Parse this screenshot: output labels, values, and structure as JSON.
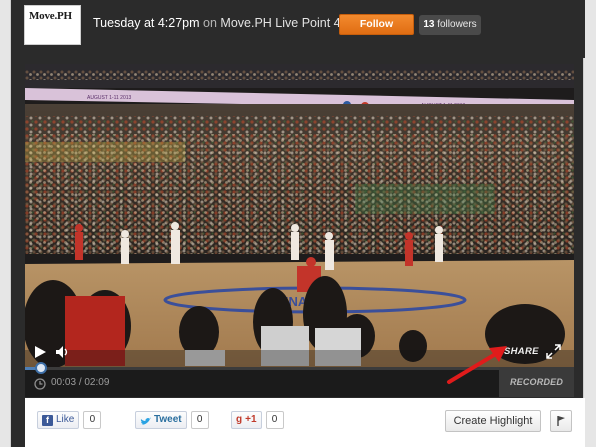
{
  "header": {
    "logo_text": "Move.PH",
    "post_time": "Tuesday at 4:27pm",
    "on_word": "on",
    "channel": "Move.PH Live Point 4",
    "follow_label": "Follow",
    "followers_count": "13",
    "followers_label": "followers"
  },
  "video": {
    "banner_text_1": "AUGUST 1-11 2013",
    "banner_text_2": "AUGUST 1-11 2013",
    "current_time": "00:03",
    "duration": "02:09",
    "time_separator": "/",
    "progress": 0.03,
    "share_label": "SHARE",
    "recorded_label": "RECORDED LIVE"
  },
  "share_bar": {
    "like_label": "Like",
    "like_count": "0",
    "tweet_label": "Tweet",
    "tweet_count": "0",
    "gplus_label": "+1",
    "gplus_count": "0",
    "create_highlight_label": "Create Highlight"
  },
  "colors": {
    "follow": "#e67817",
    "progress": "#4f7fb5",
    "annotation_arrow": "#e01b1b"
  }
}
